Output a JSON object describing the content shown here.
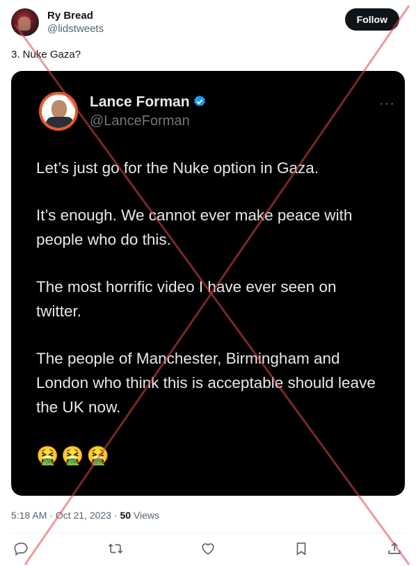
{
  "author": {
    "display_name": "Ry Bread",
    "handle": "@lidstweets",
    "follow_label": "Follow"
  },
  "tweet": {
    "text": "3. Nuke Gaza?"
  },
  "embedded_post": {
    "display_name": "Lance Forman",
    "handle": "@LanceForman",
    "more_label": "···",
    "paragraphs": [
      "Let’s just go for the Nuke option in Gaza.",
      "It’s enough.  We cannot ever make peace with people who do this.",
      "The most horrific video I have ever seen on twitter.",
      "The people of Manchester, Birmingham and London who think this is acceptable should leave the UK now."
    ],
    "emojis": "🤮🤮🤮"
  },
  "meta": {
    "time": "5:18 AM",
    "sep1": " · ",
    "date": "Oct 21, 2023",
    "sep2": " · ",
    "views_count": "50",
    "views_label": " Views"
  },
  "colors": {
    "cross": "#e0474c",
    "verified": "#1d9bf0",
    "avatar_ring": "#e8582a"
  },
  "icons": [
    "reply-icon",
    "retweet-icon",
    "like-icon",
    "bookmark-icon",
    "share-icon"
  ]
}
